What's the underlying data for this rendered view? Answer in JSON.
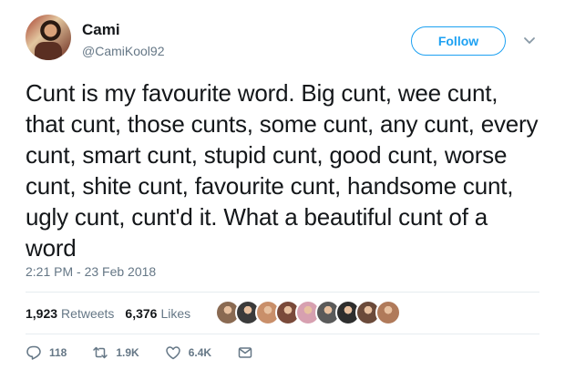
{
  "user": {
    "name": "Cami",
    "handle": "@CamiKool92"
  },
  "follow_label": "Follow",
  "tweet": {
    "text": "Cunt is my favourite word. Big cunt, wee cunt, that cunt, those cunts, some cunt, any cunt, every cunt, smart cunt, stupid cunt, good cunt, worse cunt, shite cunt, favourite cunt, handsome cunt, ugly cunt, cunt'd it. What a beautiful cunt of a word",
    "timestamp": "2:21 PM - 23 Feb 2018"
  },
  "stats": {
    "retweets_count": "1,923",
    "retweets_label": "Retweets",
    "likes_count": "6,376",
    "likes_label": "Likes"
  },
  "likers": [
    "#8a6a52",
    "#3b3b3b",
    "#c98f6a",
    "#7a4a3a",
    "#d7a0b0",
    "#5a5a5a",
    "#2e2e2e",
    "#6b4a3a",
    "#b07a5a"
  ],
  "actions": {
    "replies": "118",
    "retweets": "1.9K",
    "likes": "6.4K"
  },
  "icons": [
    "chevron-down-icon",
    "reply-icon",
    "retweet-icon",
    "heart-icon",
    "message-icon"
  ],
  "colors": {
    "accent": "#1da1f2",
    "muted": "#657786"
  }
}
